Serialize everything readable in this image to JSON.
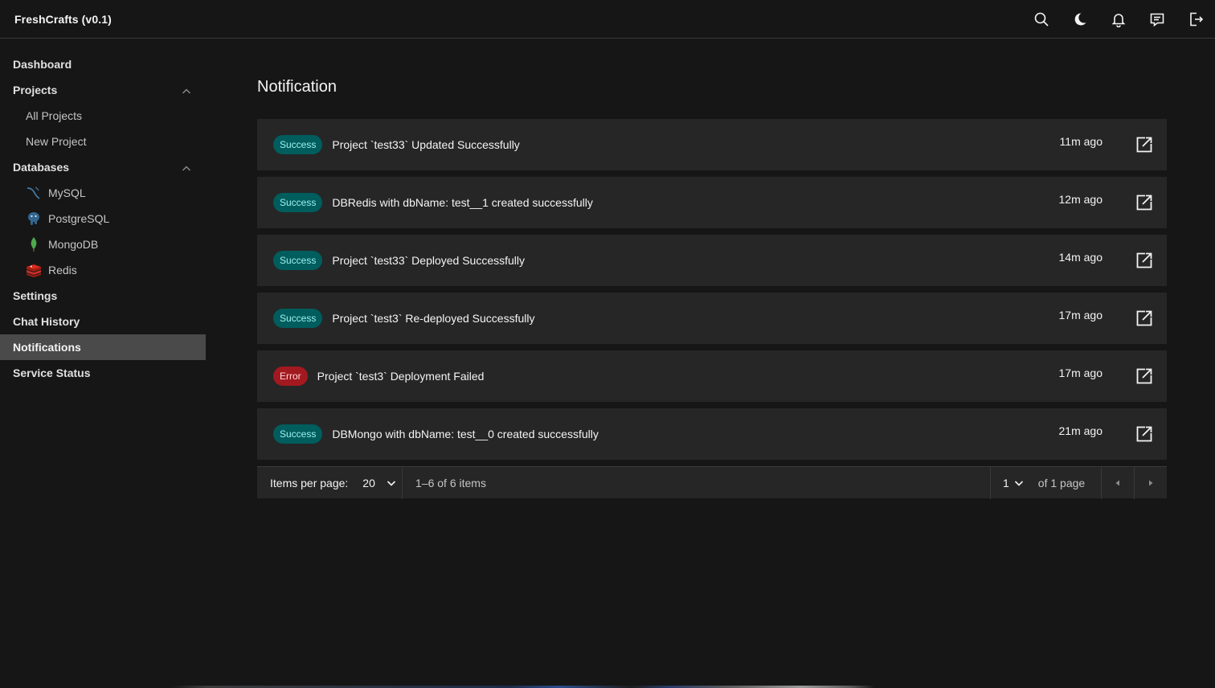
{
  "app": {
    "title": "FreshCrafts (v0.1)"
  },
  "header_icons": [
    "search-icon",
    "moon-icon",
    "bell-icon",
    "chat-icon",
    "logout-icon"
  ],
  "sidebar": {
    "dashboard": "Dashboard",
    "projects": {
      "label": "Projects",
      "items": [
        "All Projects",
        "New Project"
      ]
    },
    "databases": {
      "label": "Databases",
      "items": [
        "MySQL",
        "PostgreSQL",
        "MongoDB",
        "Redis"
      ]
    },
    "settings": "Settings",
    "chat_history": "Chat History",
    "notifications": "Notifications",
    "service_status": "Service Status"
  },
  "main": {
    "title": "Notification",
    "notifications": [
      {
        "status": "Success",
        "message": "Project `test33` Updated Successfully",
        "time": "11m ago"
      },
      {
        "status": "Success",
        "message": "DBRedis with dbName: test__1 created successfully",
        "time": "12m ago"
      },
      {
        "status": "Success",
        "message": "Project `test33` Deployed Successfully",
        "time": "14m ago"
      },
      {
        "status": "Success",
        "message": "Project `test3` Re-deployed Successfully",
        "time": "17m ago"
      },
      {
        "status": "Error",
        "message": "Project `test3` Deployment Failed",
        "time": "17m ago"
      },
      {
        "status": "Success",
        "message": "DBMongo with dbName: test__0 created successfully",
        "time": "21m ago"
      }
    ],
    "pagination": {
      "items_per_page_label": "Items per page:",
      "items_per_page": "20",
      "range": "1–6 of 6 items",
      "page": "1",
      "of_pages": "of 1 page"
    }
  },
  "colors": {
    "background": "#161616",
    "surface": "#262626",
    "success_bg": "#005d5d",
    "success_fg": "#9ef0f0",
    "error_bg": "#a2191f",
    "error_fg": "#ffd7d9",
    "active_nav": "#4a4a4a"
  }
}
